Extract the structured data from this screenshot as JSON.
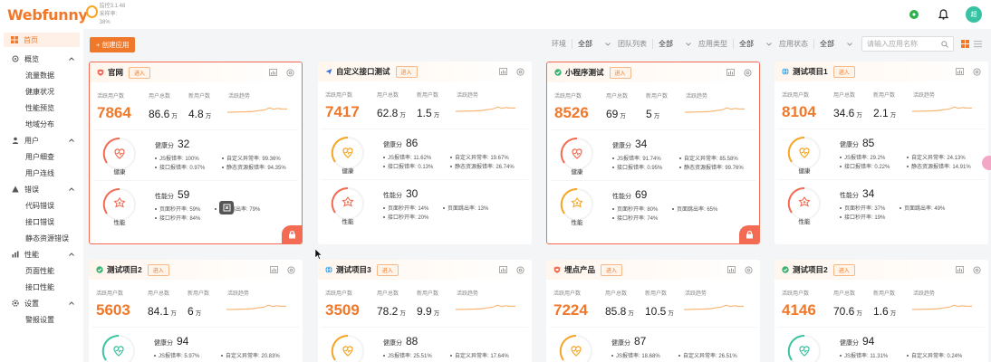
{
  "header": {
    "logo": "Webfunny",
    "version": "监控3.1.48",
    "sub": "采样率: 38%",
    "avatar": "超"
  },
  "sidebar": {
    "home": "首页",
    "groups": [
      {
        "label": "概览",
        "icon": "overview-icon",
        "items": [
          "流量数据",
          "健康状况",
          "性能预览",
          "地域分布"
        ]
      },
      {
        "label": "用户",
        "icon": "user-icon",
        "items": [
          "用户细查",
          "用户连线"
        ]
      },
      {
        "label": "错误",
        "icon": "warning-icon",
        "items": [
          "代码错误",
          "接口错误",
          "静态资源错误"
        ]
      },
      {
        "label": "性能",
        "icon": "performance-icon",
        "items": [
          "页面性能",
          "接口性能"
        ]
      },
      {
        "label": "设置",
        "icon": "settings-icon",
        "items": [
          "警报设置"
        ]
      }
    ]
  },
  "toolbar": {
    "create": "+ 创建应用",
    "filters": [
      {
        "label": "环境",
        "value": "全部"
      },
      {
        "label": "团队列表",
        "value": "全部"
      },
      {
        "label": "应用类型",
        "value": "全部"
      },
      {
        "label": "应用状态",
        "value": "全部"
      }
    ],
    "search_placeholder": "请输入应用名称"
  },
  "labels": {
    "enter": "进入",
    "active_users": "活跃用户数",
    "total_users": "用户总数",
    "new_users": "新用户数",
    "trend": "活跃趋势",
    "health": "健康",
    "health_score": "健康分",
    "perf": "性能",
    "perf_score": "性能分",
    "unit_wan": "万"
  },
  "cards": [
    {
      "name": "官网",
      "icon": "shield",
      "icon_color": "#f26b52",
      "active": "7864",
      "total": "86.6",
      "new": "4.8",
      "health": "32",
      "health_color": "#f26b52",
      "js": "JS报错率: 100%",
      "custom": "自定义异常率: 99.36%",
      "api": "接口报错率: 0.97%",
      "static": "静态资源报错率: 94.35%",
      "perf": "59",
      "perf_color": "#f26b52",
      "page_sec": "页面秒开率: 59%",
      "page_jump": "页面跳出率: 79%",
      "api_sec": "接口秒开率: 84%",
      "selected": true
    },
    {
      "name": "自定义接口测试",
      "icon": "plane",
      "icon_color": "#3b6fd8",
      "active": "7417",
      "total": "62.8",
      "new": "1.5",
      "health": "86",
      "health_color": "#f6a623",
      "js": "JS报错率: 11.62%",
      "custom": "自定义异常率: 19.67%",
      "api": "接口报错率: 0.13%",
      "static": "静态资源报错率: 26.74%",
      "perf": "30",
      "perf_color": "#f26b52",
      "page_sec": "页面秒开率: 14%",
      "page_jump": "页面跳出率: 13%",
      "api_sec": "接口秒开率: 20%",
      "selected": false
    },
    {
      "name": "小程序测试",
      "icon": "check",
      "icon_color": "#3cb371",
      "active": "8526",
      "total": "69",
      "new": "5",
      "health": "34",
      "health_color": "#f26b52",
      "js": "JS报错率: 91.74%",
      "custom": "自定义异常率: 85.58%",
      "api": "接口报错率: 0.95%",
      "static": "静态资源报错率: 99.76%",
      "perf": "69",
      "perf_color": "#f6a623",
      "page_sec": "页面秒开率: 80%",
      "page_jump": "页面跳出率: 65%",
      "api_sec": "接口秒开率: 74%",
      "selected": true
    },
    {
      "name": "测试项目1",
      "icon": "globe",
      "icon_color": "#3aa0e8",
      "active": "8104",
      "total": "34.6",
      "new": "2.1",
      "health": "85",
      "health_color": "#f6a623",
      "js": "JS报错率: 29.2%",
      "custom": "自定义异常率: 24.13%",
      "api": "接口报错率: 0.22%",
      "static": "静态资源报错率: 14.91%",
      "perf": "34",
      "perf_color": "#f26b52",
      "page_sec": "页面秒开率: 37%",
      "page_jump": "页面跳出率: 49%",
      "api_sec": "接口秒开率: 19%",
      "selected": false
    },
    {
      "name": "测试项目2",
      "icon": "check",
      "icon_color": "#3cb371",
      "active": "5603",
      "total": "84.1",
      "new": "6",
      "health": "94",
      "health_color": "#3cc39f",
      "js": "JS报错率: 5.97%",
      "custom": "自定义异常率: 20.83%",
      "selected": false
    },
    {
      "name": "测试项目3",
      "icon": "globe",
      "icon_color": "#3aa0e8",
      "active": "3509",
      "total": "78.2",
      "new": "9.9",
      "health": "88",
      "health_color": "#f6a623",
      "js": "JS报错率: 25.51%",
      "custom": "自定义异常率: 17.64%",
      "selected": false
    },
    {
      "name": "埋点产品",
      "icon": "shield",
      "icon_color": "#f26b52",
      "active": "7224",
      "total": "85.8",
      "new": "10.5",
      "health": "87",
      "health_color": "#f6a623",
      "js": "JS报错率: 18.68%",
      "custom": "自定义异常率: 26.51%",
      "selected": false
    },
    {
      "name": "测试项目2",
      "icon": "check",
      "icon_color": "#3cb371",
      "active": "4146",
      "total": "70.6",
      "new": "1.6",
      "health": "94",
      "health_color": "#3cc39f",
      "js": "JS报错率: 11.31%",
      "custom": "自定义异常率: 0.24%",
      "selected": false
    }
  ]
}
